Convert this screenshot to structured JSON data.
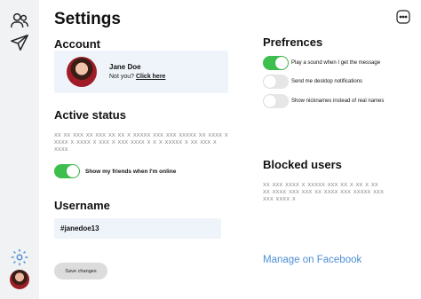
{
  "rail": {
    "icons": [
      "users-icon",
      "paper-plane-icon",
      "gear-icon"
    ]
  },
  "page": {
    "title": "Settings"
  },
  "account": {
    "heading": "Account",
    "name": "Jane Doe",
    "not_you_text": "Not you?",
    "click_here": "Click here"
  },
  "active_status": {
    "heading": "Active status",
    "placeholder_lines": [
      "XX XX XXX XX XXX XX XX X XXXXX XXX XXX XXXXX XX XXXX X",
      "XXXX X XXXX X XXX X XXX XXXX X X X XXXXX X XX XXX X XXXX"
    ],
    "toggle_label": "Show my friends when I'm online",
    "toggle_on": true
  },
  "username": {
    "heading": "Username",
    "value": "#janedoe13"
  },
  "save_button": "Save changes",
  "preferences": {
    "heading": "Prefrences",
    "items": [
      {
        "label": "Play a sound when I get the message",
        "on": true
      },
      {
        "label": "Send me desktop notifications",
        "on": false
      },
      {
        "label": "Show nicknames instead of real names",
        "on": false
      }
    ]
  },
  "blocked_users": {
    "heading": "Blocked users",
    "placeholder_lines": [
      "XX XXX XXXX X XXXXX XXX XX X XX X XX",
      "XX XXXX XXX XXX XX XXXX XXX XXXXX XXX",
      "XXX XXXX X"
    ]
  },
  "manage_link": "Manage on Facebook",
  "colors": {
    "toggle_on": "#3cbf4d",
    "link": "#4f8fd6",
    "card_bg": "#eef4fa"
  }
}
